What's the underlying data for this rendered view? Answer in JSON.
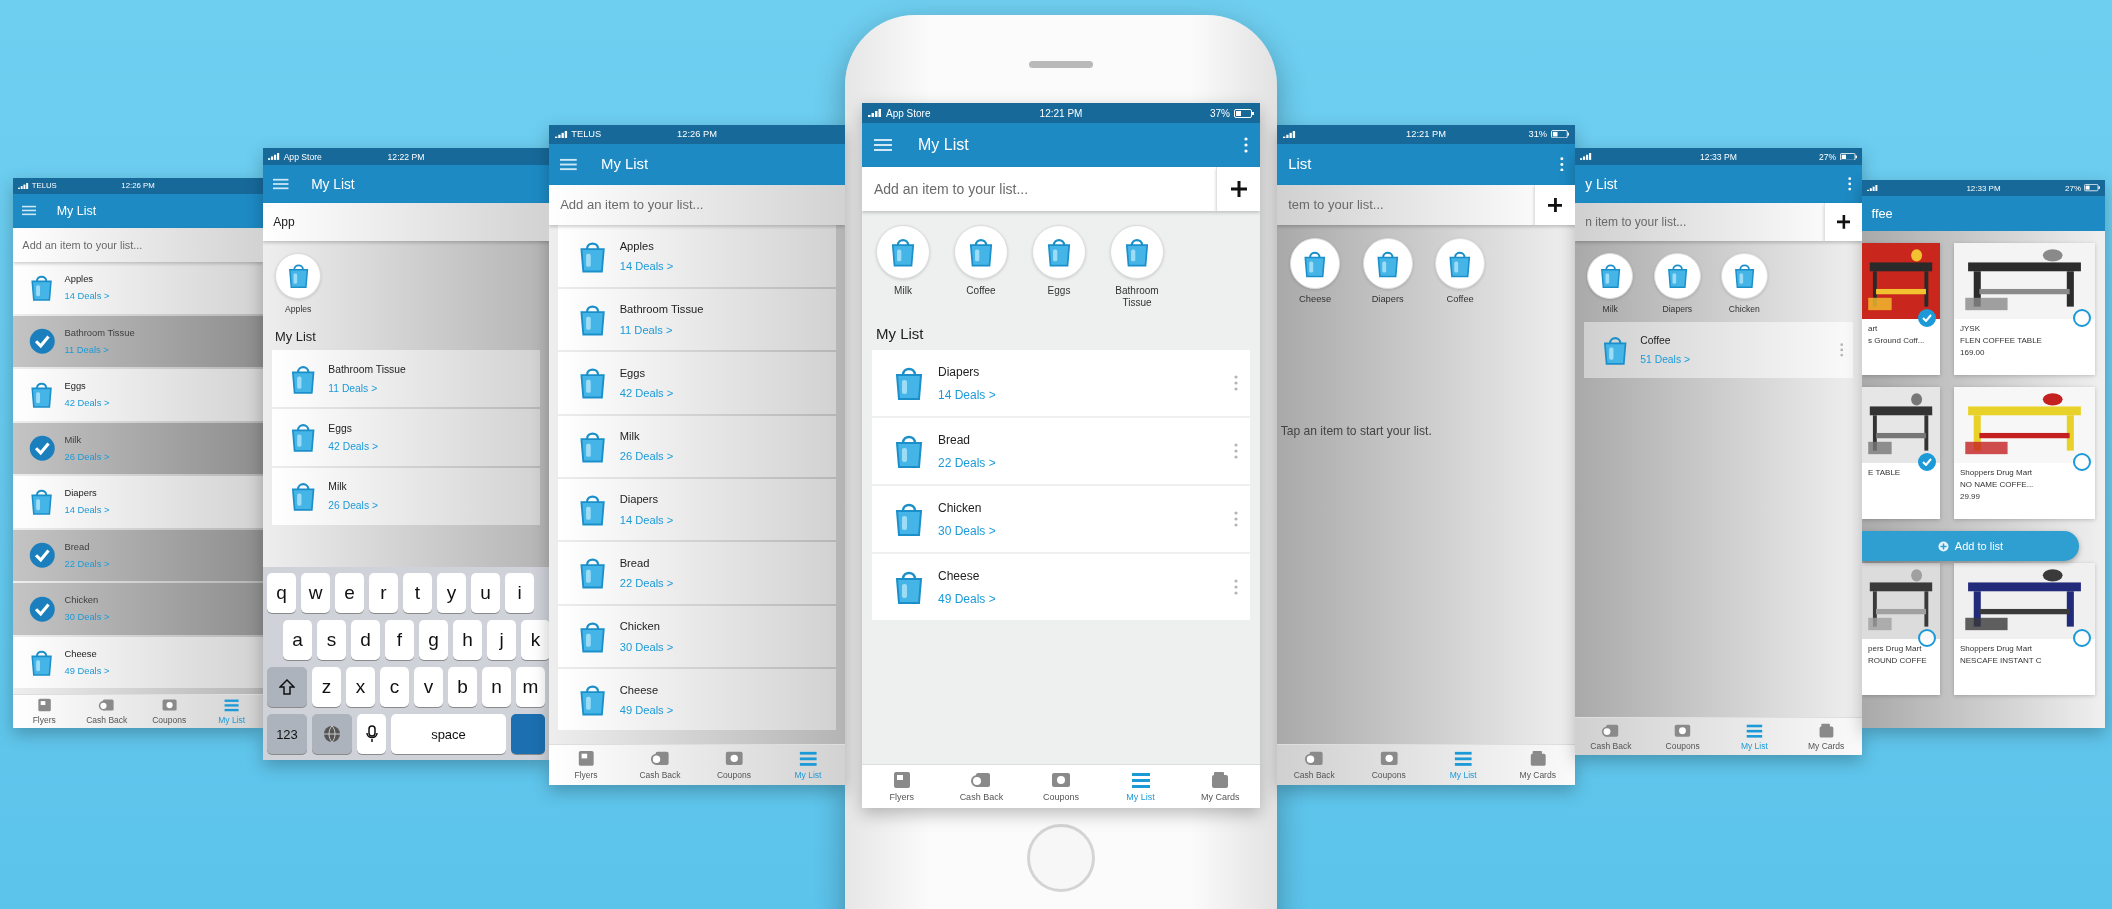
{
  "screens": [
    {
      "status": {
        "carrier": "TELUS",
        "time": "12:26 PM"
      },
      "title": "My List",
      "menu_button": true,
      "search": {
        "placeholder": "Add an item to your list..."
      },
      "sections": [
        {
          "kind": "list",
          "items": [
            {
              "name": "Apples",
              "deals": "14 Deals >",
              "checked": false
            },
            {
              "name": "Bathroom Tissue",
              "deals": "11 Deals >",
              "checked": true
            },
            {
              "name": "Eggs",
              "deals": "42 Deals >",
              "checked": false
            },
            {
              "name": "Milk",
              "deals": "26 Deals >",
              "checked": true
            },
            {
              "name": "Diapers",
              "deals": "14 Deals >",
              "checked": false
            },
            {
              "name": "Bread",
              "deals": "22 Deals >",
              "checked": true
            },
            {
              "name": "Chicken",
              "deals": "30 Deals >",
              "checked": true
            },
            {
              "name": "Cheese",
              "deals": "49 Deals >",
              "checked": false
            }
          ]
        }
      ],
      "tabs": [
        {
          "label": "Flyers",
          "kind": "flyers",
          "selected": false
        },
        {
          "label": "Cash Back",
          "kind": "cashback",
          "selected": false
        },
        {
          "label": "Coupons",
          "kind": "coupons",
          "selected": false
        },
        {
          "label": "My List",
          "kind": "list",
          "selected": true
        }
      ]
    },
    {
      "status": {
        "carrier": "App Store",
        "time": "12:22 PM"
      },
      "title": "My List",
      "menu_button": true,
      "search": {
        "value": "App"
      },
      "sections": [
        {
          "kind": "quick",
          "items": [
            {
              "name": "Apples"
            }
          ]
        },
        {
          "kind": "heading",
          "text": "My List"
        },
        {
          "kind": "list",
          "items": [
            {
              "name": "Bathroom Tissue",
              "deals": "11 Deals >"
            },
            {
              "name": "Eggs",
              "deals": "42 Deals >"
            },
            {
              "name": "Milk",
              "deals": "26 Deals >"
            }
          ]
        },
        {
          "kind": "keyboard",
          "key_rows": [
            {
              "keys": [
                {
                  "kind": "letter",
                  "label": "q"
                },
                {
                  "kind": "letter",
                  "label": "w"
                },
                {
                  "kind": "letter",
                  "label": "e"
                },
                {
                  "kind": "letter",
                  "label": "r"
                },
                {
                  "kind": "letter",
                  "label": "t"
                },
                {
                  "kind": "letter",
                  "label": "y"
                },
                {
                  "kind": "letter",
                  "label": "u"
                },
                {
                  "kind": "letter",
                  "label": "i"
                }
              ]
            },
            {
              "keys": [
                {
                  "kind": "letter",
                  "label": "a"
                },
                {
                  "kind": "letter",
                  "label": "s"
                },
                {
                  "kind": "letter",
                  "label": "d"
                },
                {
                  "kind": "letter",
                  "label": "f"
                },
                {
                  "kind": "letter",
                  "label": "g"
                },
                {
                  "kind": "letter",
                  "label": "h"
                },
                {
                  "kind": "letter",
                  "label": "j"
                },
                {
                  "kind": "letter",
                  "label": "k"
                }
              ]
            },
            {
              "keys": [
                {
                  "kind": "shift"
                },
                {
                  "kind": "letter",
                  "label": "z"
                },
                {
                  "kind": "letter",
                  "label": "x"
                },
                {
                  "kind": "letter",
                  "label": "c"
                },
                {
                  "kind": "letter",
                  "label": "v"
                },
                {
                  "kind": "letter",
                  "label": "b"
                },
                {
                  "kind": "letter",
                  "label": "n"
                },
                {
                  "kind": "letter",
                  "label": "m"
                }
              ]
            },
            {
              "keys": [
                {
                  "kind": "numbers",
                  "label": "123"
                },
                {
                  "kind": "globe"
                },
                {
                  "kind": "mic"
                },
                {
                  "kind": "space",
                  "label": "space"
                },
                {
                  "kind": "return"
                }
              ]
            }
          ]
        }
      ]
    },
    {
      "status": {
        "carrier": "TELUS",
        "time": "12:26 PM"
      },
      "title": "My List",
      "menu_button": true,
      "search": {
        "placeholder": "Add an item to your list..."
      },
      "sections": [
        {
          "kind": "list",
          "items": [
            {
              "name": "Apples",
              "deals": "14 Deals >"
            },
            {
              "name": "Bathroom Tissue",
              "deals": "11 Deals >"
            },
            {
              "name": "Eggs",
              "deals": "42 Deals >"
            },
            {
              "name": "Milk",
              "deals": "26 Deals >"
            },
            {
              "name": "Diapers",
              "deals": "14 Deals >"
            },
            {
              "name": "Bread",
              "deals": "22 Deals >"
            },
            {
              "name": "Chicken",
              "deals": "30 Deals >"
            },
            {
              "name": "Cheese",
              "deals": "49 Deals >"
            }
          ]
        }
      ],
      "tabs": [
        {
          "label": "Flyers",
          "kind": "flyers",
          "selected": false
        },
        {
          "label": "Cash Back",
          "kind": "cashback",
          "selected": false
        },
        {
          "label": "Coupons",
          "kind": "coupons",
          "selected": false
        },
        {
          "label": "My List",
          "kind": "list",
          "selected": true
        }
      ]
    },
    {
      "status": {
        "carrier": "App Store",
        "time": "12:21 PM",
        "battery": "37%"
      },
      "title": "My List",
      "menu_button": true,
      "more_button": true,
      "search": {
        "placeholder": "Add an item to your list...",
        "add_button": true
      },
      "sections": [
        {
          "kind": "quick",
          "items": [
            {
              "name": "Milk"
            },
            {
              "name": "Coffee"
            },
            {
              "name": "Eggs"
            },
            {
              "name": "Bathroom Tissue"
            }
          ]
        },
        {
          "kind": "heading",
          "text": "My List"
        },
        {
          "kind": "list",
          "item_menus": true,
          "items": [
            {
              "name": "Diapers",
              "deals": "14 Deals >"
            },
            {
              "name": "Bread",
              "deals": "22 Deals >"
            },
            {
              "name": "Chicken",
              "deals": "30 Deals >"
            },
            {
              "name": "Cheese",
              "deals": "49 Deals >"
            }
          ]
        }
      ],
      "tabs": [
        {
          "label": "Flyers",
          "kind": "flyers",
          "selected": false
        },
        {
          "label": "Cash Back",
          "kind": "cashback",
          "selected": false
        },
        {
          "label": "Coupons",
          "kind": "coupons",
          "selected": false
        },
        {
          "label": "My List",
          "kind": "list",
          "selected": true
        },
        {
          "label": "My Cards",
          "kind": "cards",
          "selected": false
        }
      ]
    },
    {
      "status": {
        "time": "12:21 PM",
        "battery": "31%"
      },
      "title": "List",
      "more_button": true,
      "search": {
        "placeholder": "tem to your list...",
        "add_button": true
      },
      "sections": [
        {
          "kind": "quick",
          "items": [
            {
              "name": "Cheese"
            },
            {
              "name": "Diapers"
            },
            {
              "name": "Coffee"
            }
          ]
        },
        {
          "kind": "empty",
          "text": "Tap an item to start your list."
        }
      ],
      "tabs": [
        {
          "label": "Cash Back",
          "kind": "cashback",
          "selected": false
        },
        {
          "label": "Coupons",
          "kind": "coupons",
          "selected": false
        },
        {
          "label": "My List",
          "kind": "list",
          "selected": true
        },
        {
          "label": "My Cards",
          "kind": "cards",
          "selected": false
        }
      ]
    },
    {
      "status": {
        "time": "12:33 PM",
        "battery": "27%"
      },
      "title": "y List",
      "more_button": true,
      "search": {
        "placeholder": "n item to your list...",
        "add_button": true
      },
      "sections": [
        {
          "kind": "quick",
          "items": [
            {
              "name": "Milk"
            },
            {
              "name": "Diapers"
            },
            {
              "name": "Chicken"
            }
          ]
        },
        {
          "kind": "list",
          "item_menus": true,
          "items": [
            {
              "name": "Coffee",
              "deals": "51 Deals >"
            }
          ]
        }
      ],
      "tabs": [
        {
          "label": "Cash Back",
          "kind": "cashback",
          "selected": false
        },
        {
          "label": "Coupons",
          "kind": "coupons",
          "selected": false
        },
        {
          "label": "My List",
          "kind": "list",
          "selected": true
        },
        {
          "label": "My Cards",
          "kind": "cards",
          "selected": false
        }
      ]
    },
    {
      "status": {
        "time": "12:33 PM",
        "battery": "27%"
      },
      "title": "ffee",
      "sections": [
        {
          "kind": "grid",
          "cards": [
            {
              "lines": [
                "art",
                "s Ground Coff..."
              ],
              "selected": true
            },
            {
              "lines": [
                "JYSK",
                "FLEN COFFEE TABLE",
                "169.00"
              ],
              "selected": false
            },
            {
              "lines": [
                "E TABLE"
              ],
              "selected": true
            },
            {
              "lines": [
                "Shoppers Drug Mart",
                "NO NAME COFFE...",
                "29.99"
              ],
              "selected": false
            },
            {
              "lines": [
                "pers Drug Mart",
                "ROUND COFFE"
              ],
              "selected": false
            },
            {
              "lines": [
                "Shoppers Drug Mart",
                "NESCAFE INSTANT C"
              ],
              "selected": false
            }
          ]
        }
      ],
      "action": {
        "label": "Add to list"
      }
    }
  ]
}
